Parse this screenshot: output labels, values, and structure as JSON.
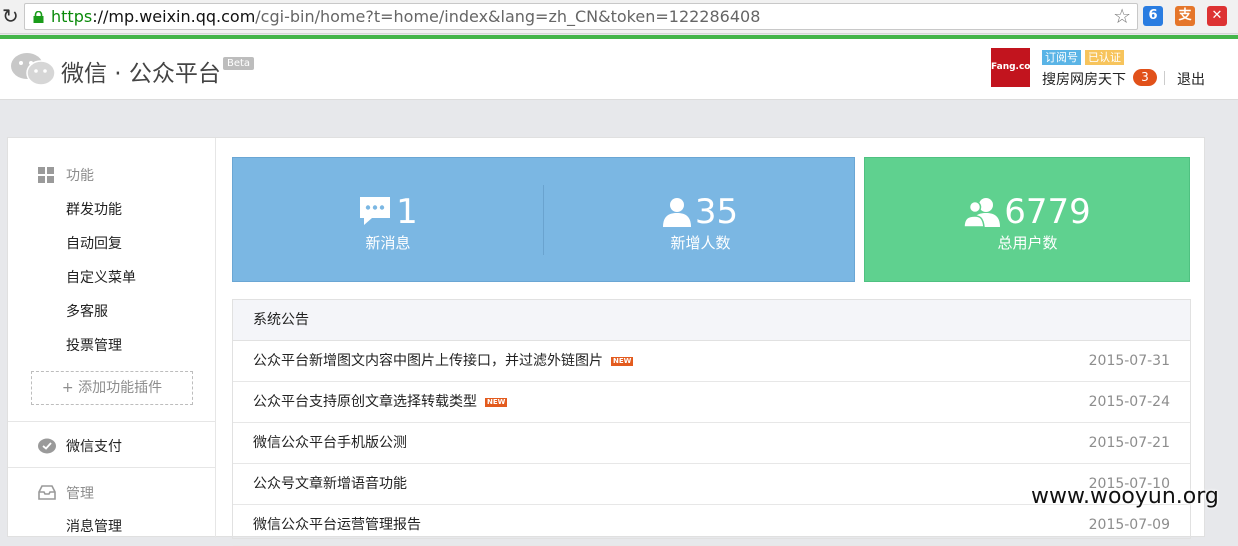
{
  "browser": {
    "url_scheme": "https",
    "url_host": "://mp.weixin.qq.com",
    "url_path": "/cgi-bin/home?t=home/index&lang=zh_CN&token=122286408"
  },
  "header": {
    "logo_text": "微信 · 公众平台",
    "beta": "Beta",
    "account": {
      "avatar_text": "Fang.com",
      "type_tag": "订阅号",
      "verified_tag": "已认证",
      "name": "搜房网房天下",
      "badge_count": "3",
      "logout": "退出"
    }
  },
  "sidebar": {
    "function_head": "功能",
    "function_items": [
      "群发功能",
      "自动回复",
      "自定义菜单",
      "多客服",
      "投票管理"
    ],
    "add_plugin": "+ 添加功能插件",
    "pay_head": "微信支付",
    "manage_head": "管理",
    "manage_items": [
      "消息管理"
    ]
  },
  "stats": {
    "new_messages": {
      "value": "1",
      "label": "新消息"
    },
    "new_users": {
      "value": "35",
      "label": "新增人数"
    },
    "total_users": {
      "value": "6779",
      "label": "总用户数"
    }
  },
  "notices": {
    "title": "系统公告",
    "new_tag": "NEW",
    "items": [
      {
        "title": "公众平台新增图文内容中图片上传接口，并过滤外链图片",
        "date": "2015-07-31",
        "is_new": true
      },
      {
        "title": "公众平台支持原创文章选择转载类型",
        "date": "2015-07-24",
        "is_new": true
      },
      {
        "title": "微信公众平台手机版公测",
        "date": "2015-07-21",
        "is_new": false
      },
      {
        "title": "公众号文章新增语音功能",
        "date": "2015-07-10",
        "is_new": false
      },
      {
        "title": "微信公众平台运营管理报告",
        "date": "2015-07-09",
        "is_new": false
      }
    ]
  },
  "watermark": "www.wooyun.org",
  "colors": {
    "brand_green": "#44b549",
    "stat_blue": "#7bb7e3",
    "stat_green": "#5fd18f",
    "badge_orange": "#e1511a"
  }
}
